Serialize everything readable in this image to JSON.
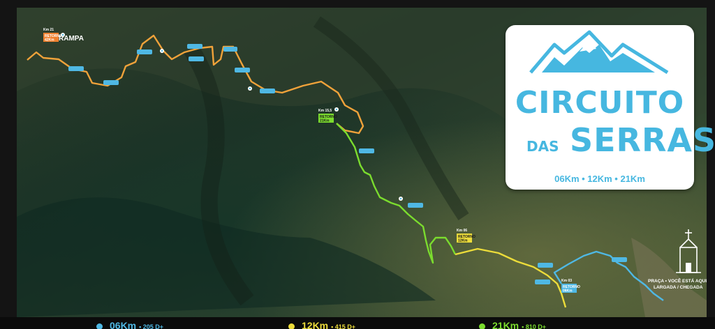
{
  "brand": {
    "title_line1": "CIRCUITO",
    "title_small": "DAS",
    "title_line2": "SERRAS",
    "distances": "06Km • 12Km • 21Km"
  },
  "places": {
    "rampa_label": "RAMPA",
    "rampa_km": "Km 21",
    "praca_line1": "PRAÇA • VOCÊ ESTÁ AQUI",
    "praca_line2": "LARGADA / CHEGADA"
  },
  "turnarounds": [
    {
      "km": "Km 21",
      "label": "RETORNO",
      "dist": "42Km",
      "color": "#f0812f"
    },
    {
      "km": "Km 15,5",
      "label": "RETORNO",
      "dist": "21Km",
      "color": "#7bdc2e"
    },
    {
      "km": "Km 06",
      "label": "RETORNO",
      "dist": "12Km",
      "color": "#ecdc3a"
    },
    {
      "km": "Km 03",
      "label": "RETORNO",
      "dist": "06Km",
      "color": "#4fb8e4"
    }
  ],
  "legend": [
    {
      "dist": "06Km",
      "gain": "• 205 D+",
      "color": "#4fb8e4"
    },
    {
      "dist": "12Km",
      "gain": "• 415 D+",
      "color": "#ecdc3a"
    },
    {
      "dist": "21Km",
      "gain": "• 810 D+",
      "color": "#7bdc2e"
    }
  ],
  "colors": {
    "route_21": "#f0a23a",
    "route_15": "#7bdc2e",
    "route_12": "#ecdc3a",
    "route_06": "#4fb8e4",
    "brand": "#46b7e0"
  },
  "icons": [
    "mountain-logo-icon",
    "church-icon",
    "pin-icon"
  ]
}
